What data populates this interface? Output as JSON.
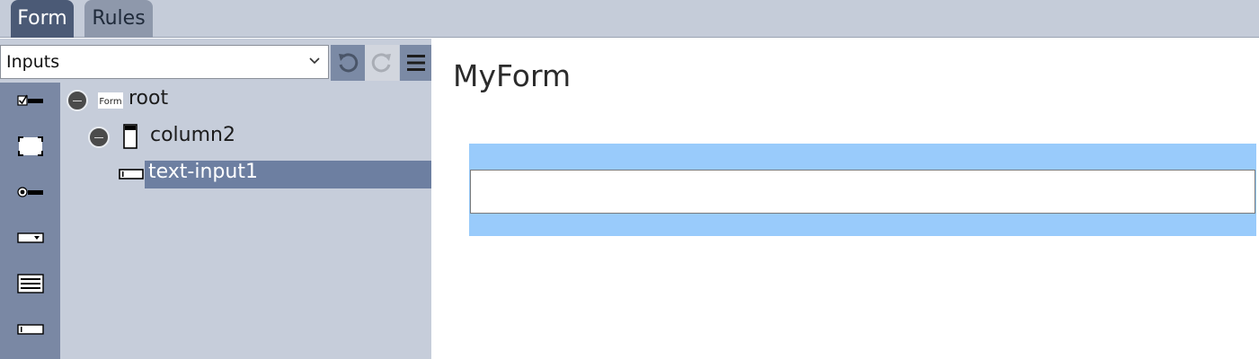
{
  "tabs": [
    {
      "label": "Form",
      "active": true
    },
    {
      "label": "Rules",
      "active": false
    }
  ],
  "toolbar": {
    "dropdown_value": "Inputs",
    "undo_icon": "undo-icon",
    "redo_icon": "redo-icon",
    "menu_icon": "hamburger-menu-icon"
  },
  "palette": [
    {
      "icon": "checkbox-input-icon"
    },
    {
      "icon": "container-frame-icon"
    },
    {
      "icon": "radio-input-icon"
    },
    {
      "icon": "select-dropdown-icon"
    },
    {
      "icon": "textarea-icon"
    },
    {
      "icon": "text-input-icon"
    }
  ],
  "tree": {
    "nodes": [
      {
        "label": "root",
        "badge": "Form",
        "icon": "form-icon"
      },
      {
        "label": "column2",
        "icon": "column-icon"
      },
      {
        "label": "text-input1",
        "icon": "text-input-icon",
        "selected": true
      }
    ]
  },
  "preview": {
    "title": "MyForm",
    "column_color": "#99cbfb"
  },
  "colors": {
    "tab_active": "#4b5a76",
    "panel_bg": "#c6cdda",
    "palette_bg": "#7a88a4",
    "selection": "#6d7fa1"
  }
}
